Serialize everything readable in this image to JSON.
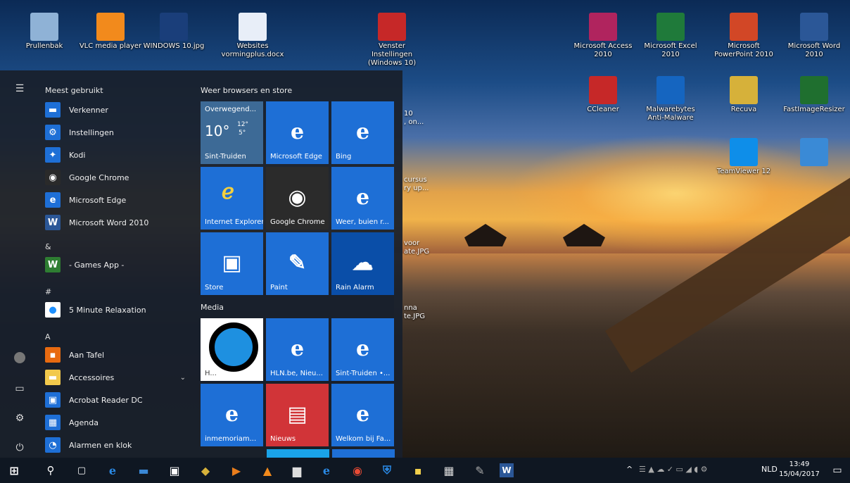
{
  "desktop": {
    "icons": [
      {
        "label": "Prullenbak",
        "icon": "recycle-bin-icon",
        "color": "#8fb2d6"
      },
      {
        "label": "VLC media player",
        "icon": "vlc-icon",
        "color": "#f28a1c"
      },
      {
        "label": "WINDOWS 10.jpg",
        "icon": "image-file-icon",
        "color": "#1a3e7a"
      },
      {
        "label": "Websites vormingplus.docx",
        "icon": "word-document-icon",
        "color": "#e8eef8"
      },
      {
        "label": "Venster Instellingen (Windows 10)",
        "icon": "book-shortcut-icon",
        "color": "#c62828"
      },
      {
        "label": "Microsoft Access 2010",
        "icon": "access-icon",
        "color": "#b0245e"
      },
      {
        "label": "Microsoft Excel 2010",
        "icon": "excel-icon",
        "color": "#1f7a3a"
      },
      {
        "label": "Microsoft PowerPoint 2010",
        "icon": "powerpoint-icon",
        "color": "#d24726"
      },
      {
        "label": "Microsoft Word 2010",
        "icon": "word-icon",
        "color": "#2b5797"
      },
      {
        "label": "CCleaner",
        "icon": "ccleaner-icon",
        "color": "#c62828"
      },
      {
        "label": "Malwarebytes Anti-Malware",
        "icon": "malwarebytes-icon",
        "color": "#1565c0"
      },
      {
        "label": "Recuva",
        "icon": "recuva-icon",
        "color": "#d6b13a"
      },
      {
        "label": "FastImageResizer",
        "icon": "fastimageresizer-icon",
        "color": "#1f6f2f"
      },
      {
        "label": "TeamViewer 12",
        "icon": "teamviewer-icon",
        "color": "#0e8ee9"
      },
      {
        "label": "",
        "icon": "control-panel-icon",
        "color": "#3a8ad6"
      }
    ],
    "partial_labels": [
      "10",
      ", on...",
      "cursus",
      "ry up...",
      "voor",
      "ate.JPG",
      "nna",
      "te.JPG"
    ]
  },
  "start": {
    "most_used_title": "Meest gebruikt",
    "most_used": [
      {
        "label": "Verkenner",
        "icon": "folder-icon",
        "color": "#1e6fd6"
      },
      {
        "label": "Instellingen",
        "icon": "gear-icon",
        "color": "#1e6fd6"
      },
      {
        "label": "Kodi",
        "icon": "kodi-icon",
        "color": "#1e6fd6"
      },
      {
        "label": "Google Chrome",
        "icon": "chrome-icon",
        "color": "#2a2a2a"
      },
      {
        "label": "Microsoft Edge",
        "icon": "edge-icon",
        "color": "#1e6fd6"
      },
      {
        "label": "Microsoft Word 2010",
        "icon": "word-icon",
        "color": "#2b5797"
      }
    ],
    "sections": [
      {
        "letter": "&",
        "items": [
          {
            "label": "- Games App -",
            "icon": "games-app-icon",
            "color": "#2e7d32"
          }
        ]
      },
      {
        "letter": "#",
        "items": [
          {
            "label": "5 Minute Relaxation",
            "icon": "relaxation-icon",
            "color": "#ffffff"
          }
        ]
      },
      {
        "letter": "A",
        "items": [
          {
            "label": "Aan Tafel",
            "icon": "aan-tafel-icon",
            "color": "#e86a10"
          },
          {
            "label": "Accessoires",
            "icon": "folder-icon",
            "color": "#f2c94c",
            "expandable": true
          },
          {
            "label": "Acrobat Reader DC",
            "icon": "acrobat-icon",
            "color": "#1e6fd6"
          },
          {
            "label": "Agenda",
            "icon": "calendar-icon",
            "color": "#1e6fd6"
          },
          {
            "label": "Alarmen en klok",
            "icon": "alarm-clock-icon",
            "color": "#1e6fd6"
          }
        ]
      }
    ],
    "tile_groups": [
      {
        "title": "Weer browsers en store",
        "tiles": [
          {
            "label": "Sint-Truiden",
            "icon": "weather-icon",
            "color": "#3d6a96",
            "weather": {
              "header": "Overwegend...",
              "temp": "10°",
              "high": "12°",
              "low": "5°"
            }
          },
          {
            "label": "Microsoft Edge",
            "icon": "edge-icon",
            "color": "#1e6fd6"
          },
          {
            "label": "Bing",
            "icon": "edge-icon",
            "color": "#1e6fd6"
          },
          {
            "label": "Internet Explorer",
            "icon": "internet-explorer-icon",
            "color": "#1e6fd6"
          },
          {
            "label": "Google Chrome",
            "icon": "chrome-icon",
            "color": "#2b2b2b"
          },
          {
            "label": "Weer, buien r...",
            "icon": "edge-icon",
            "color": "#1e6fd6"
          },
          {
            "label": "Store",
            "icon": "store-icon",
            "color": "#1e6fd6"
          },
          {
            "label": "Paint",
            "icon": "paint-icon",
            "color": "#1e6fd6"
          },
          {
            "label": "Rain Alarm",
            "icon": "rain-alarm-icon",
            "color": "#0a4ea8"
          }
        ]
      },
      {
        "title": "Media",
        "tiles": [
          {
            "label": "H...",
            "icon": "relaxation-icon",
            "color": "#ffffff"
          },
          {
            "label": "HLN.be, Nieu...",
            "icon": "edge-icon",
            "color": "#1e6fd6"
          },
          {
            "label": "Sint-Truiden •...",
            "icon": "edge-icon",
            "color": "#1e6fd6"
          },
          {
            "label": "inmemoriam...",
            "icon": "edge-icon",
            "color": "#1e6fd6"
          },
          {
            "label": "Nieuws",
            "icon": "news-icon",
            "color": "#d13438"
          },
          {
            "label": "Welkom bij Fa...",
            "icon": "edge-icon",
            "color": "#1e6fd6"
          }
        ]
      }
    ]
  },
  "taskbar": {
    "lang": "NLD",
    "time": "13:49",
    "date": "15/04/2017"
  }
}
